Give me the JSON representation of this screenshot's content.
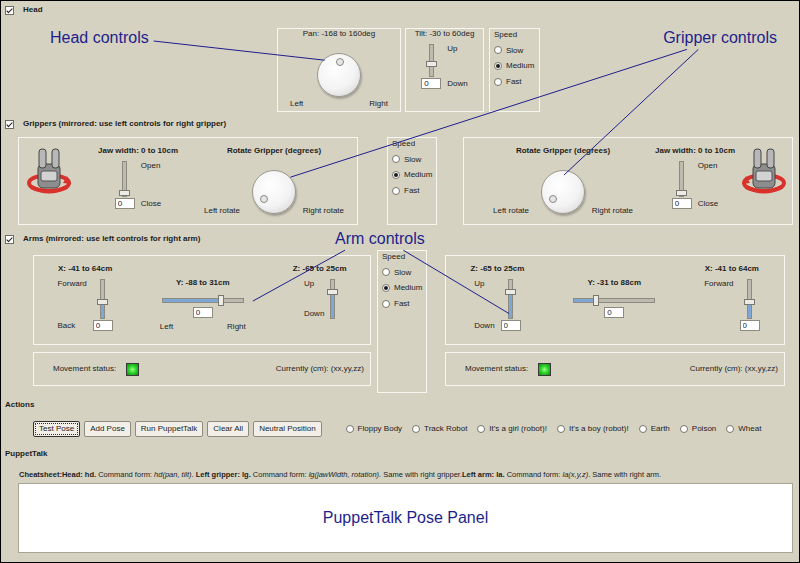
{
  "annotations": {
    "head": "Head controls",
    "gripper": "Gripper controls",
    "arm": "Arm controls",
    "pose_panel": "PuppetTalk Pose Panel"
  },
  "head": {
    "label": "Head",
    "checked": true,
    "pan": {
      "title": "Pan: -168 to 160deg",
      "left": "Left",
      "right": "Right",
      "level": 0.52
    },
    "tilt": {
      "title": "Tilt: -30 to 60deg",
      "top": "Up",
      "bottom": "Down",
      "level": 0.35,
      "value": "0"
    },
    "speed": {
      "title": "Speed",
      "options": [
        {
          "label": "Slow",
          "selected": false
        },
        {
          "label": "Medium",
          "selected": true
        },
        {
          "label": "Fast",
          "selected": false
        }
      ]
    }
  },
  "grippers": {
    "label": "Grippers (mirrored: use left controls for right gripper)",
    "checked": true,
    "left": {
      "jaw": {
        "title": "Jaw width: 0 to 10cm",
        "top": "Open",
        "bottom": "Close",
        "level": 0,
        "value": "0"
      },
      "rotate": {
        "title": "Rotate Gripper (degrees)",
        "left": "Left rotate",
        "right": "Right rotate",
        "level": 0.03
      }
    },
    "speed": {
      "title": "Speed",
      "options": [
        {
          "label": "Slow",
          "selected": false
        },
        {
          "label": "Medium",
          "selected": true
        },
        {
          "label": "Fast",
          "selected": false
        }
      ]
    },
    "right": {
      "jaw": {
        "title": "Jaw width: 0 to 10cm",
        "top": "Open",
        "bottom": "Close",
        "level": 0,
        "value": "0"
      },
      "rotate": {
        "title": "Rotate Gripper (degrees)",
        "left": "Left rotate",
        "right": "Right rotate",
        "level": 0.03
      }
    }
  },
  "arms": {
    "label": "Arms (mirrored: use left controls for right arm)",
    "checked": true,
    "left": {
      "axes": [
        {
          "kind": "vertical",
          "title": "X: -41 to 64cm",
          "top": "Forward",
          "bottom": "Back",
          "level": 0.39,
          "value": "0"
        },
        {
          "kind": "horizontal",
          "title": "Y: -88 to 31cm",
          "start": "Left",
          "end": "Right",
          "level": 0.74,
          "value": "0"
        },
        {
          "kind": "vertical",
          "title": "Z: -65 to 25cm",
          "top": "Up",
          "bottom": "Down",
          "level": 0.72
        }
      ],
      "status": {
        "label": "Movement status:",
        "on": true,
        "current": "Currently (cm): (xx,yy,zz)"
      }
    },
    "speed": {
      "title": "Speed",
      "options": [
        {
          "label": "Slow",
          "selected": false
        },
        {
          "label": "Medium",
          "selected": true
        },
        {
          "label": "Fast",
          "selected": false
        }
      ]
    },
    "right": {
      "axes": [
        {
          "kind": "vertical",
          "title": "Z: -65 to 25cm",
          "top": "Up",
          "bottom": "Down",
          "level": 0.72,
          "value": "0"
        },
        {
          "kind": "horizontal",
          "title": "Y: -31 to 88cm",
          "level": 0.26,
          "value": "0"
        },
        {
          "kind": "vertical",
          "title": "X: -41 to 64cm",
          "top": "Forward",
          "level": 0.39,
          "value": "0"
        }
      ],
      "status": {
        "label": "Movement status:",
        "on": true,
        "current": "Currently (cm): (xx,yy,zz)"
      }
    }
  },
  "actions": {
    "label": "Actions",
    "buttons": [
      {
        "label": "Test Pose",
        "focused": true
      },
      {
        "label": "Add Pose",
        "focused": false
      },
      {
        "label": "Run PuppetTalk",
        "focused": false
      },
      {
        "label": "Clear All",
        "focused": false
      },
      {
        "label": "Neutral Position",
        "focused": false
      }
    ],
    "poses": [
      {
        "label": "Floppy Body",
        "selected": false
      },
      {
        "label": "Track Robot",
        "selected": false
      },
      {
        "label": "It's a girl (robot)!",
        "selected": false
      },
      {
        "label": "It's a boy (robot)!",
        "selected": false
      },
      {
        "label": "Earth",
        "selected": false
      },
      {
        "label": "Poison",
        "selected": false
      },
      {
        "label": "Wheat",
        "selected": false
      }
    ]
  },
  "puppettalk": {
    "label": "PuppetTalk",
    "cheatsheet": [
      {
        "text": "Cheatsheet:Head: hd.",
        "kind": "bold"
      },
      {
        "text": " Command form: ",
        "kind": "plain"
      },
      {
        "text": "hd(pan, tilt)",
        "kind": "italic"
      },
      {
        "text": ". ",
        "kind": "plain"
      },
      {
        "text": "Left gripper: lg.",
        "kind": "bold"
      },
      {
        "text": " Command form: ",
        "kind": "plain"
      },
      {
        "text": "lg(jawWidth, rotation)",
        "kind": "italic"
      },
      {
        "text": ". Same with right gripper.",
        "kind": "plain"
      },
      {
        "text": "Left arm: la.",
        "kind": "bold"
      },
      {
        "text": " Command form: ",
        "kind": "plain"
      },
      {
        "text": "la(x,y,z)",
        "kind": "italic"
      },
      {
        "text": ". Same with right arm.",
        "kind": "plain"
      }
    ]
  }
}
